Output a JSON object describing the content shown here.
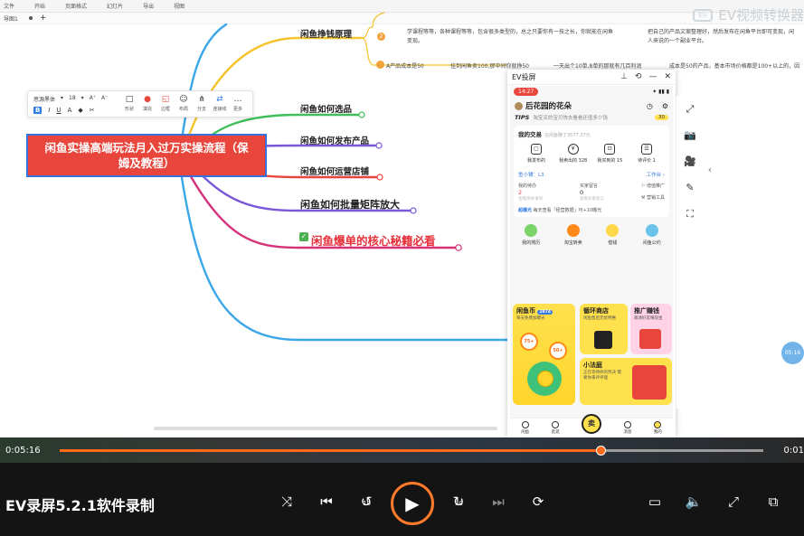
{
  "menubar": {
    "items": [
      "文件",
      "开始",
      "页面格式",
      "幻灯片",
      "导出",
      "视图"
    ]
  },
  "tabbar": {
    "tab_label": "导图1",
    "add": "+"
  },
  "watermark": {
    "logo": "EV",
    "text": "EV视频转换器"
  },
  "format_toolbar": {
    "font_name": "思源黑体",
    "font_size": "18",
    "style_buttons": [
      "B",
      "I",
      "U",
      "A",
      "◆",
      "✂"
    ],
    "tools": [
      {
        "icon": "□",
        "label": "形状"
      },
      {
        "icon": "●",
        "label": "填充"
      },
      {
        "icon": "◱",
        "label": "边框"
      },
      {
        "icon": "☺",
        "label": "布局"
      },
      {
        "icon": "⋔",
        "label": "分支"
      },
      {
        "icon": "⇄",
        "label": "连接线"
      },
      {
        "icon": "…",
        "label": "更多"
      }
    ]
  },
  "mindmap": {
    "root": "闲鱼实操高端玩法月入过万实操流程（保姆及教程）",
    "branches": {
      "principle": "闲鱼挣钱原理",
      "select": "闲鱼如何选品",
      "publish": "闲鱼如何发布产品",
      "operate": "闲鱼如何运营店铺",
      "matrix": "闲鱼如何批量矩阵放大",
      "secret": "闲鱼爆单的核心秘籍必看"
    },
    "details": {
      "d1": "学课程等等，各种课程等等，包含很多类型的，总之只要你有一技之长，你就能在闲鱼",
      "d1b": "变现。",
      "d2": "A产品成本是50",
      "d3": "挂到闲鱼卖100,那中间你就挣50",
      "d4": "一天出个10单,8单的那就有几百利润",
      "d5": "成本是50的产品，基本市场价格都是100+以上的，因",
      "d6": "把自己的产品文案整理好，然后发布在闲鱼平台即可变现，闲",
      "d6b": "人来说的一个副业平台。",
      "num": "2"
    }
  },
  "phone_window": {
    "title": "EV投屏",
    "time": "14:27",
    "status_icons": "✦ ▮▮ ▮",
    "username": "后花园的花朵",
    "tips_label": "TIPS",
    "tips_text": "淘宝买的宝贝快去看看还值多少钱",
    "tips_count": "30",
    "trade": {
      "heading": "我的交易",
      "sub": "在闲鱼赚了3577.37元",
      "items": [
        "我发布的",
        "我卖出的 328",
        "我买到的 15",
        "待评价 1"
      ]
    },
    "shop": {
      "label": "鱼小铺：L3",
      "workbench": "工作台 ›"
    },
    "stats": [
      {
        "label": "我的待办",
        "value": "2",
        "sub": "查看待办事项"
      },
      {
        "label": "买家留言",
        "value": "0",
        "sub": "查看买家留言"
      },
      {
        "label": "增值推广",
        "value": "",
        "sub": ""
      },
      {
        "label": "营销工具",
        "value": "",
        "sub": ""
      }
    ],
    "exposure": {
      "label": "超曝光",
      "text": "每天查看「经营数据」可+10曝光"
    },
    "services": [
      "我的简历",
      "淘宝转卖",
      "借钱",
      "闲鱼公约"
    ],
    "tiles": {
      "coin": {
        "title": "闲鱼币",
        "badge": "2874",
        "sub": "每天免费加曝光"
      },
      "cycle": {
        "title": "循环商店",
        "sub": "闲鱼售后无忧特惠"
      },
      "promo": {
        "title": "推广赚钱",
        "sub": "邀请好友赚现金"
      },
      "bank": {
        "title": "小法庭",
        "sub": "正在等待你的判决 需要你来评评理"
      },
      "coin_bubble1": "75+",
      "coin_bubble2": "50+"
    },
    "nav": [
      "闲鱼",
      "逛逛",
      "卖闲置",
      "消息",
      "我的"
    ]
  },
  "side_tools": [
    "⤢",
    "📷",
    "🎥",
    "✎",
    "⛶"
  ],
  "bubble": "05:16",
  "video": {
    "time_current": "0:05:16",
    "time_total": "0:01",
    "progress_fraction": 0.768,
    "recorder_title": "EV录屏5.2.1软件录制",
    "seek_back_label": "10",
    "seek_forward_label": "30",
    "buttons": [
      "shuffle",
      "prev",
      "back10",
      "play",
      "fwd30",
      "next",
      "loop",
      "subtitle",
      "volume",
      "fullscreen",
      "pip"
    ]
  },
  "colors": {
    "accent": "#ff6a1a",
    "root_fill": "#e8463c",
    "secret_red": "#e8303a"
  }
}
